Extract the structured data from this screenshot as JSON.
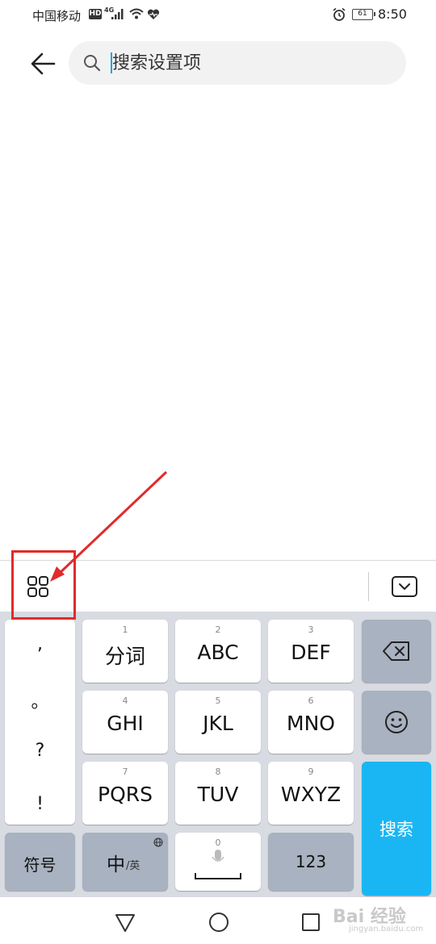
{
  "status_bar": {
    "carrier": "中国移动",
    "hd": "HD",
    "network": "4G",
    "battery": "61",
    "time": "8:50"
  },
  "header": {
    "search_placeholder": "搜索设置项"
  },
  "keyboard": {
    "punctuation": [
      ",",
      "。",
      "?",
      "!"
    ],
    "keys": [
      {
        "num": "1",
        "label": "分词"
      },
      {
        "num": "2",
        "label": "ABC"
      },
      {
        "num": "3",
        "label": "DEF"
      },
      {
        "num": "4",
        "label": "GHI"
      },
      {
        "num": "5",
        "label": "JKL"
      },
      {
        "num": "6",
        "label": "MNO"
      },
      {
        "num": "7",
        "label": "PQRS"
      },
      {
        "num": "8",
        "label": "TUV"
      },
      {
        "num": "9",
        "label": "WXYZ"
      }
    ],
    "symbols_label": "符号",
    "lang_main": "中",
    "lang_sub": "/英",
    "space_num": "0",
    "numbers_label": "123",
    "search_label": "搜索"
  },
  "watermark": {
    "text": "Bai 经验",
    "sub": "jingyan.baidu.com"
  },
  "colors": {
    "accent": "#1ab6f3",
    "annotation": "#e02b2b",
    "function_key": "#a8b2c0"
  }
}
